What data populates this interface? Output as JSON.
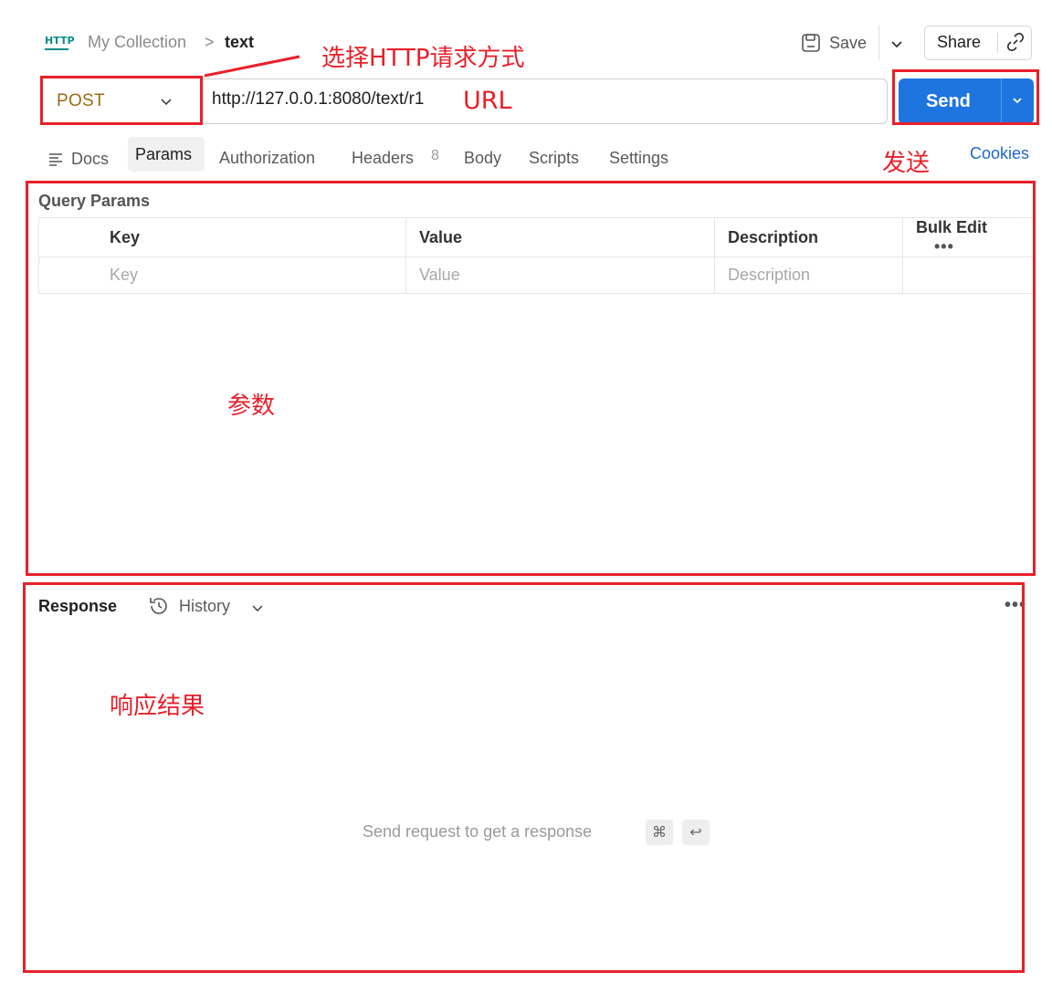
{
  "header": {
    "logo_text": "HTTP",
    "breadcrumb_collection": "My Collection",
    "breadcrumb_separator": ">",
    "breadcrumb_current": "text",
    "save_label": "Save",
    "share_label": "Share"
  },
  "request": {
    "method": "POST",
    "url": "http://127.0.0.1:8080/text/r1",
    "send_label": "Send"
  },
  "tabs": {
    "docs": "Docs",
    "params": "Params",
    "authorization": "Authorization",
    "headers": "Headers",
    "headers_count": "8",
    "body": "Body",
    "scripts": "Scripts",
    "settings": "Settings",
    "active": "Params",
    "cookies": "Cookies"
  },
  "query_params": {
    "title": "Query Params",
    "columns": [
      "Key",
      "Value",
      "Description"
    ],
    "bulk_edit": "Bulk Edit",
    "more": "•••",
    "placeholders": [
      "Key",
      "Value",
      "Description"
    ]
  },
  "response": {
    "title": "Response",
    "history": "History",
    "more": "•••",
    "empty_message": "Send request to get a response",
    "shortcut_keys": [
      "⌘",
      "↩"
    ]
  },
  "annotations": {
    "method": "选择HTTP请求方式",
    "url": "URL",
    "send": "发送",
    "params": "参数",
    "response": "响应结果"
  },
  "colors": {
    "accent": "#1f75e0",
    "method_post": "#9c6a12",
    "annotation": "#e8202a",
    "link": "#1f66c9"
  },
  "icons": [
    "http-logo-icon",
    "chevron-right-icon",
    "save-icon",
    "chevron-down-icon",
    "link-icon",
    "docs-icon",
    "history-icon",
    "more-icon",
    "command-key-icon",
    "enter-key-icon"
  ]
}
